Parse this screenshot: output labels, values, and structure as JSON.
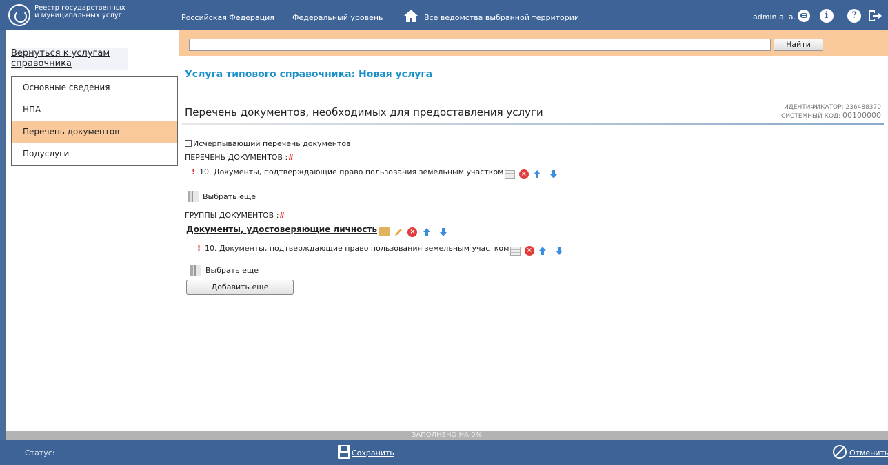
{
  "header": {
    "logo_text": "Реестр государственных и муниципальных услуг",
    "region_link": "Российская Федерация",
    "level": "Федеральный уровень",
    "agencies_link": "Все ведомства выбранной территории",
    "user": "admin a. a.",
    "icons": [
      "chat-icon",
      "info-icon",
      "help-icon",
      "logout-icon"
    ]
  },
  "sidebar": {
    "back_link": "Вернуться к услугам справочника",
    "items": [
      {
        "label": "Основные сведения",
        "active": false
      },
      {
        "label": "НПА",
        "active": false
      },
      {
        "label": "Перечень документов",
        "active": true
      },
      {
        "label": "Подуслуги",
        "active": false
      }
    ]
  },
  "search": {
    "value": "",
    "button": "Найти"
  },
  "main": {
    "service_title": "Услуга типового  справочника: Новая услуга",
    "section_title": "Перечень документов, необходимых для предоставления услуги",
    "identifier_label": "ИДЕНТИФИКАТОР:",
    "identifier_value": "236488370",
    "system_code_label": "СИСТЕМНЫЙ КОД:",
    "system_code_value": "00100000",
    "exhaustive_checkbox": "Исчерпывающий перечень документов",
    "exhaustive_checked": false,
    "documents_label": "ПЕРЕЧЕНЬ ДОКУМЕНТОВ :",
    "hash": "#",
    "documents": [
      {
        "text": "10. Документы, подтверждающие право пользования земельным участком"
      }
    ],
    "select_more": "Выбрать еще",
    "groups_label": "ГРУППЫ ДОКУМЕНТОВ :",
    "groups": [
      {
        "title": "Документы, удостоверяющие личность",
        "documents": [
          {
            "text": "10. Документы, подтверждающие право пользования земельным участком"
          }
        ]
      }
    ],
    "add_more": "Добавить еще"
  },
  "progress": {
    "label": "ЗАПОЛНЕНО НА 0%",
    "percent": 0
  },
  "footer": {
    "status_label": "Статус:",
    "save": "Сохранить",
    "cancel": "Отменить"
  },
  "colors": {
    "brand": "#3d6397",
    "accent": "#f9c89b",
    "title": "#1a8fc9",
    "required": "#e22222"
  }
}
